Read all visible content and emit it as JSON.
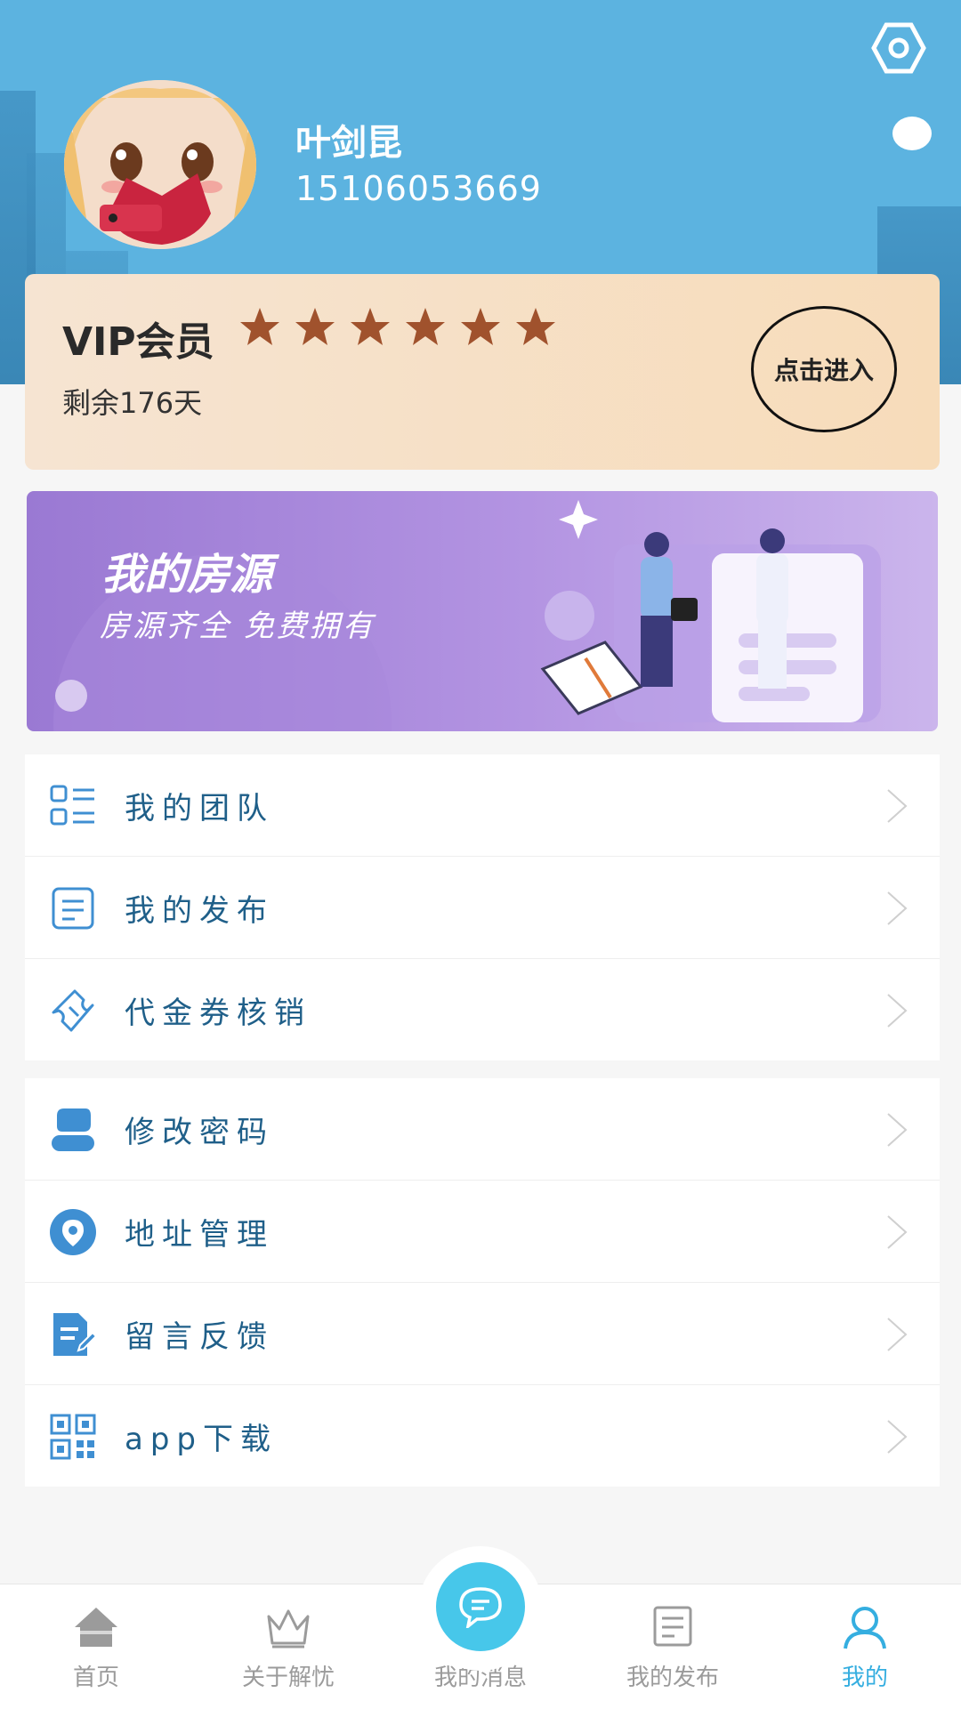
{
  "profile": {
    "name": "叶剑昆",
    "phone": "15106053669"
  },
  "vip": {
    "title": "VIP会员",
    "stars": 6,
    "remaining": "剩余176天",
    "enter_label": "点击进入"
  },
  "banner": {
    "title": "我的房源",
    "subtitle": "房源齐全 免费拥有"
  },
  "menu_group1": [
    {
      "label": "我的团队",
      "icon": "team-icon"
    },
    {
      "label": "我的发布",
      "icon": "publish-icon"
    },
    {
      "label": "代金券核销",
      "icon": "coupon-icon"
    }
  ],
  "menu_group2": [
    {
      "label": "修改密码",
      "icon": "user-password-icon"
    },
    {
      "label": "地址管理",
      "icon": "location-icon"
    },
    {
      "label": "留言反馈",
      "icon": "feedback-icon"
    },
    {
      "label": "app下载",
      "icon": "qrcode-icon"
    }
  ],
  "tabbar": {
    "items": [
      {
        "label": "首页",
        "icon": "home-icon"
      },
      {
        "label": "关于解忧",
        "icon": "crown-icon"
      },
      {
        "label": "我的消息",
        "icon": "chat-icon"
      },
      {
        "label": "我的发布",
        "icon": "publish-icon"
      },
      {
        "label": "我的",
        "icon": "user-icon"
      }
    ],
    "active_index": 4
  },
  "colors": {
    "header_bg": "#5cb3e0",
    "menu_text": "#1f5f89",
    "star": "#a0522d",
    "tab_active": "#35aee0",
    "tab_inactive": "#9b9b9b"
  }
}
